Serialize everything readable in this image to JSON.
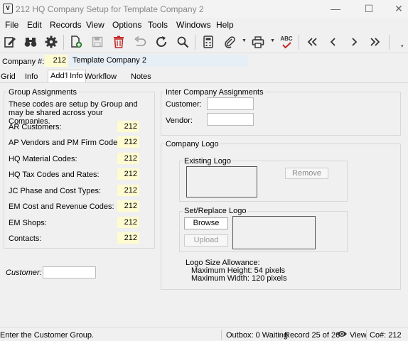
{
  "window": {
    "title": "212 HQ Company Setup for Template Company 2",
    "icon_label": "V",
    "minimize": "—",
    "maximize": "☐",
    "close": "✕"
  },
  "menu": [
    "File",
    "Edit",
    "Records",
    "View",
    "Options",
    "Tools",
    "Windows",
    "Help"
  ],
  "toolbar": {
    "icons": [
      "edit-icon",
      "binoculars-icon",
      "gear-icon",
      "new-record-icon",
      "save-icon",
      "delete-icon",
      "undo-icon",
      "refresh-icon",
      "search-icon",
      "calculator-icon",
      "attachment-icon",
      "print-icon",
      "spellcheck-icon",
      "first-record-icon",
      "previous-record-icon",
      "next-record-icon",
      "last-record-icon"
    ],
    "spellcheck_label": "ABC"
  },
  "company": {
    "label": "Company #:",
    "number": "212",
    "name": "Template Company 2"
  },
  "tabs": [
    "Grid",
    "Info",
    "Add'l Info",
    "Workflow",
    "Notes"
  ],
  "group_assignments": {
    "title": "Group Assignments",
    "description": "These codes are setup by Group and may be shared across your Companies.",
    "rows": [
      {
        "label": "AR Customers:",
        "value": "212"
      },
      {
        "label": "AP Vendors and PM Firm Codes:",
        "value": "212"
      },
      {
        "label": "HQ Material Codes:",
        "value": "212"
      },
      {
        "label": "HQ Tax Codes and Rates:",
        "value": "212"
      },
      {
        "label": "JC Phase and Cost Types:",
        "value": "212"
      },
      {
        "label": "EM Cost and Revenue Codes:",
        "value": "212"
      },
      {
        "label": "EM Shops:",
        "value": "212"
      },
      {
        "label": "Contacts:",
        "value": "212"
      }
    ]
  },
  "customer_field": {
    "label": "Customer:",
    "value": ""
  },
  "inter_company": {
    "title": "Inter Company Assignments",
    "customer_label": "Customer:",
    "customer_value": "",
    "vendor_label": "Vendor:",
    "vendor_value": ""
  },
  "company_logo": {
    "title": "Company Logo",
    "existing_title": "Existing Logo",
    "remove_label": "Remove",
    "set_title": "Set/Replace Logo",
    "browse_label": "Browse",
    "upload_label": "Upload",
    "allowance_title": "Logo Size Allowance:",
    "max_height": "Maximum Height: 54 pixels",
    "max_width": "Maximum Width: 120 pixels"
  },
  "status": {
    "message": "Enter the Customer Group.",
    "outbox": "Outbox: 0 Waiting",
    "record": "Record 25 of 26",
    "view": "View",
    "company": "Co#: 212"
  }
}
